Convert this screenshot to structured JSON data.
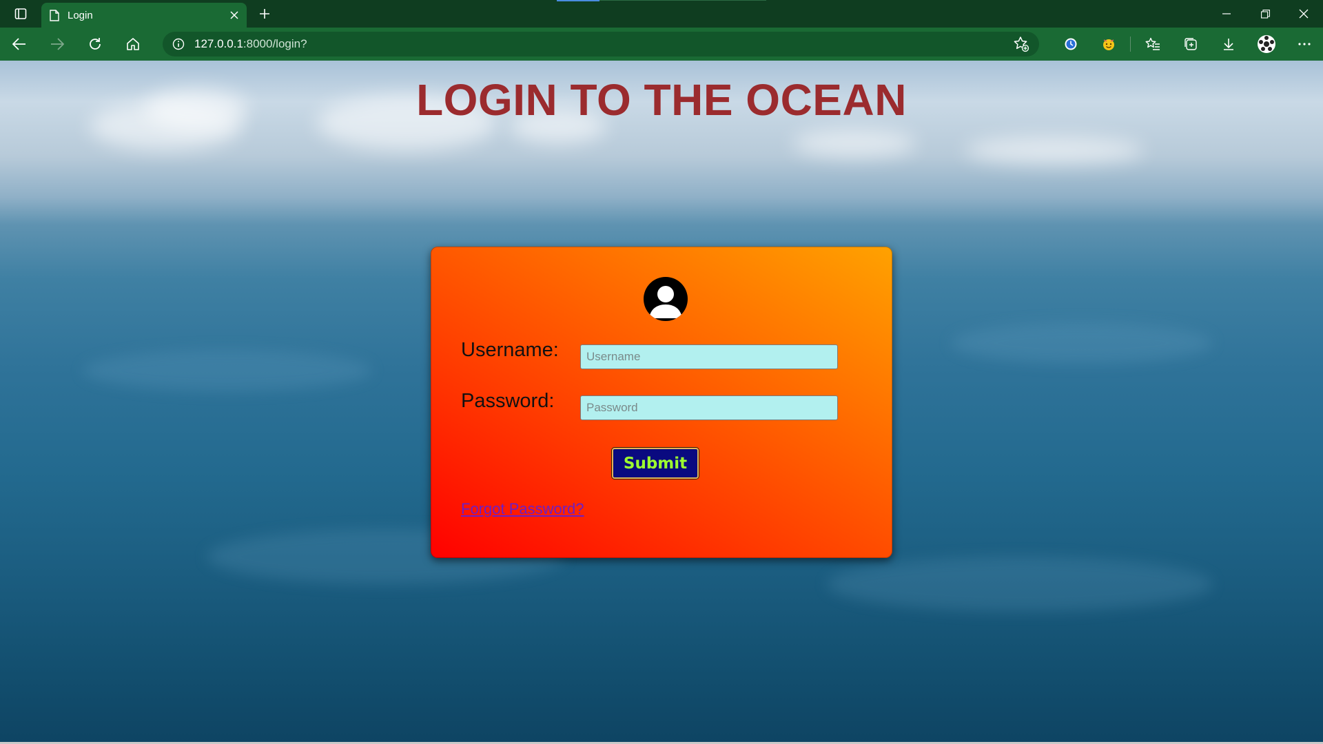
{
  "browser": {
    "tab": {
      "title": "Login"
    },
    "address": {
      "host": "127.0.0.1",
      "path": ":8000/login?"
    }
  },
  "page": {
    "title": "LOGIN TO THE OCEAN",
    "form": {
      "username_label": "Username:",
      "username_placeholder": "Username",
      "password_label": "Password:",
      "password_placeholder": "Password",
      "submit_label": "Submit",
      "forgot_link": "Forgot Password?"
    }
  },
  "colors": {
    "title": "#9b2b2e",
    "card_gradient_start": "#ff0000",
    "card_gradient_end": "#ffa200",
    "input_bg": "#b2f0ef",
    "button_bg": "#0a0a80",
    "button_text": "#9dff2f",
    "link": "#6b1fc8",
    "browser_chrome": "#1a6a34"
  },
  "icons": [
    "tab-actions-icon",
    "page-icon",
    "close-tab-icon",
    "new-tab-icon",
    "minimize-icon",
    "restore-icon",
    "close-window-icon",
    "back-icon",
    "forward-icon",
    "refresh-icon",
    "home-icon",
    "site-info-icon",
    "add-favorite-icon",
    "extension-clock-icon",
    "extension-emoji-icon",
    "favorites-icon",
    "collections-icon",
    "downloads-icon",
    "profile-avatar-icon",
    "more-icon",
    "user-avatar-icon"
  ]
}
